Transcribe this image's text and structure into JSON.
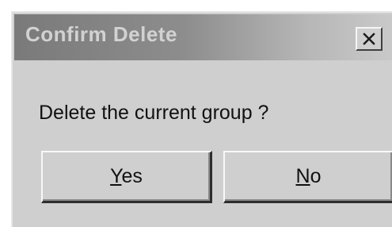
{
  "dialog": {
    "title": "Confirm Delete",
    "message": "Delete the current group ?",
    "close_icon": "close-x-icon"
  },
  "buttons": {
    "yes": {
      "mnemonic": "Y",
      "rest": "es",
      "label": "Yes"
    },
    "no": {
      "mnemonic": "N",
      "rest": "o",
      "label": "No"
    }
  },
  "colors": {
    "dialog_face": "#cfcfcf",
    "titlebar_start": "#7a7a7a",
    "titlebar_end": "#c9c9c9",
    "title_text": "#d2d2d2"
  }
}
